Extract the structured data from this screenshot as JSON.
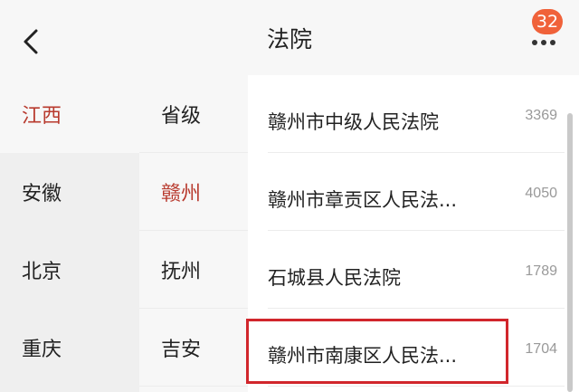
{
  "header": {
    "title": "法院",
    "badge_count": "32"
  },
  "provinces": [
    {
      "label": "江西",
      "active": true
    },
    {
      "label": "安徽",
      "active": false
    },
    {
      "label": "北京",
      "active": false
    },
    {
      "label": "重庆",
      "active": false
    }
  ],
  "cities": [
    {
      "label": "省级",
      "active": false
    },
    {
      "label": "赣州",
      "active": true
    },
    {
      "label": "抚州",
      "active": false
    },
    {
      "label": "吉安",
      "active": false
    }
  ],
  "courts": [
    {
      "name": "赣州市中级人民法院",
      "count": "3369"
    },
    {
      "name": "赣州市章贡区人民法...",
      "count": "4050"
    },
    {
      "name": "石城县人民法院",
      "count": "1789"
    },
    {
      "name": "赣州市南康区人民法...",
      "count": "1704"
    }
  ],
  "colors": {
    "accent": "#b83a2e",
    "badge": "#f0623a",
    "highlight_box": "#d1262c"
  },
  "icons": {
    "back": "chevron-left",
    "more": "more-dots"
  }
}
